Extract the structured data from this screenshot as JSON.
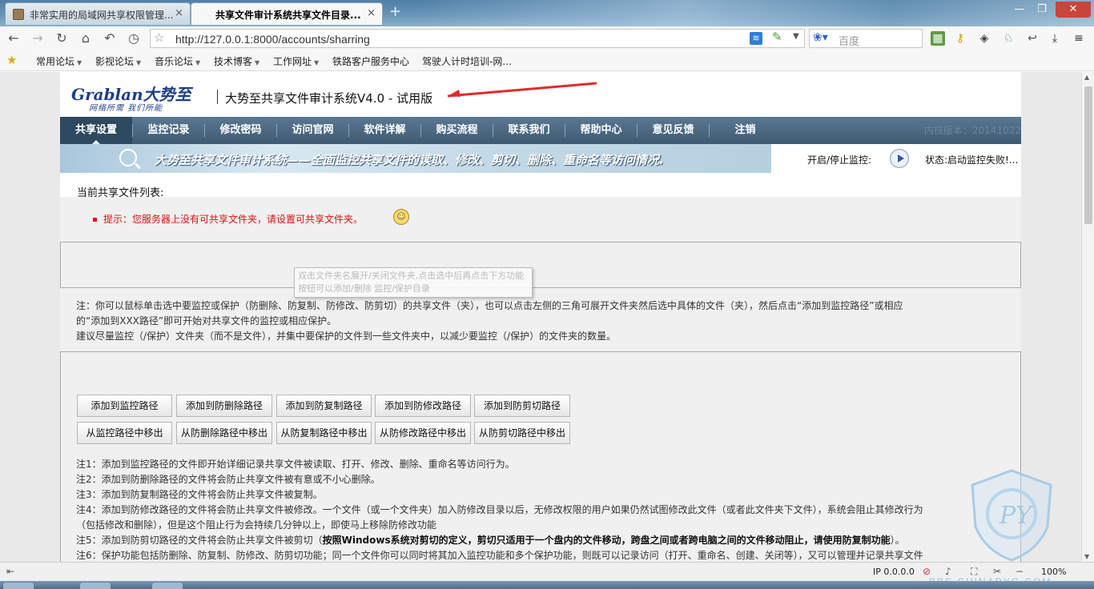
{
  "browser": {
    "tabs": [
      {
        "title": "非常实用的局域网共享权限管理...",
        "close": "×"
      },
      {
        "title": "共享文件审计系统共享文件目录...",
        "close": "×"
      }
    ],
    "new_tab": "+",
    "window_controls": {
      "minimize": "—",
      "maximize": "❐",
      "close": "✕"
    },
    "url": "http://127.0.0.1:8000/accounts/sharring",
    "search_placeholder": "百度",
    "bookmarks": [
      {
        "label": "常用论坛",
        "dropdown": true
      },
      {
        "label": "影视论坛",
        "dropdown": true
      },
      {
        "label": "音乐论坛",
        "dropdown": true
      },
      {
        "label": "技术博客",
        "dropdown": true
      },
      {
        "label": "工作网址",
        "dropdown": true
      },
      {
        "label": "铁路客户服务中心",
        "dropdown": false
      },
      {
        "label": "驾驶人计时培训-网...",
        "dropdown": false
      }
    ],
    "statusbar": {
      "ip": "IP 0.0.0.0",
      "zoom": "100%"
    }
  },
  "header": {
    "logo_main": "Grablan大势至",
    "logo_sub": "网络所需  我们所能",
    "title": "大势至共享文件审计系统V4.0 - 试用版"
  },
  "menu": {
    "items": [
      "共享设置",
      "监控记录",
      "修改密码",
      "访问官网",
      "软件详解",
      "购买流程",
      "联系我们",
      "帮助中心",
      "意见反馈",
      "注销"
    ],
    "version": "内核版本：20141022"
  },
  "banner": {
    "text": "大势至共享文件审计系统——全面监控共享文件的读取、修改、剪切、删除、重命名等访问情况.",
    "monitor_label": "开启/停止监控:",
    "status": "状态:启动监控失败!..."
  },
  "content": {
    "list_title": "当前共享文件列表:",
    "hint": "提示：您服务器上没有可共享文件夹，请设置可共享文件夹。",
    "tooltip": "双击文件夹名展开/关闭文件夹,点击选中后再点击下方功能按钮可以添加/删除 监控/保护目录",
    "note_lines": [
      "注：你可以鼠标单击选中要监控或保护（防删除、防复制、防修改、防剪切）的共享文件（夹），也可以点击左侧的三角可展开文件夹然后选中具体的文件（夹），然后点击“添加到监控路径”或相应",
      "的“添加到XXX路径”即可开始对共享文件的监控或相应保护。",
      "建议尽量监控（/保护）文件夹（而不是文件），并集中要保护的文件到一些文件夹中，以减少要监控（/保护）的文件夹的数量。"
    ],
    "add_buttons": [
      "添加到监控路径",
      "添加到防删除路径",
      "添加到防复制路径",
      "添加到防修改路径",
      "添加到防剪切路径"
    ],
    "remove_buttons": [
      "从监控路径中移出",
      "从防删除路径中移出",
      "从防复制路径中移出",
      "从防修改路径中移出",
      "从防剪切路径中移出"
    ],
    "notes": [
      "注1：添加到监控路径的文件即开始详细记录共享文件被读取、打开、修改、删除、重命名等访问行为。",
      "注2：添加到防删除路径的文件将会防止共享文件被有意或不小心删除。",
      "注3：添加到防复制路径的文件将会防止共享文件被复制。",
      "注4：添加到防修改路径的文件将会防止共享文件被修改。一个文件（或一个文件夹）加入防修改目录以后，无修改权限的用户如果仍然试图修改此文件（或者此文件夹下文件），系统会阻止其修改行为",
      "（包括修改和删除），但是这个阻止行为会持续几分钟以上，即使马上移除防修改功能",
      "注6：保护功能包括防删除、防复制、防修改、防剪切功能；同一个文件你可以同时将其加入监控功能和多个保护功能，则既可以记录访问（打开、重命名、创建、关闭等），又可以管理并记录共享文件"
    ],
    "note5_normal": "注5：添加到防剪切路径的文件将会防止共享文件被剪切（",
    "note5_bold": "按照Windows系统对剪切的定义，剪切只适用于一个盘内的文件移动，跨盘之间或者跨电脑之间的文件移动阻止，请使用防复制功能",
    "note5_end": "）。"
  },
  "watermark": {
    "letters": "PY",
    "text": "BBS.CHINAPYG.COM"
  }
}
